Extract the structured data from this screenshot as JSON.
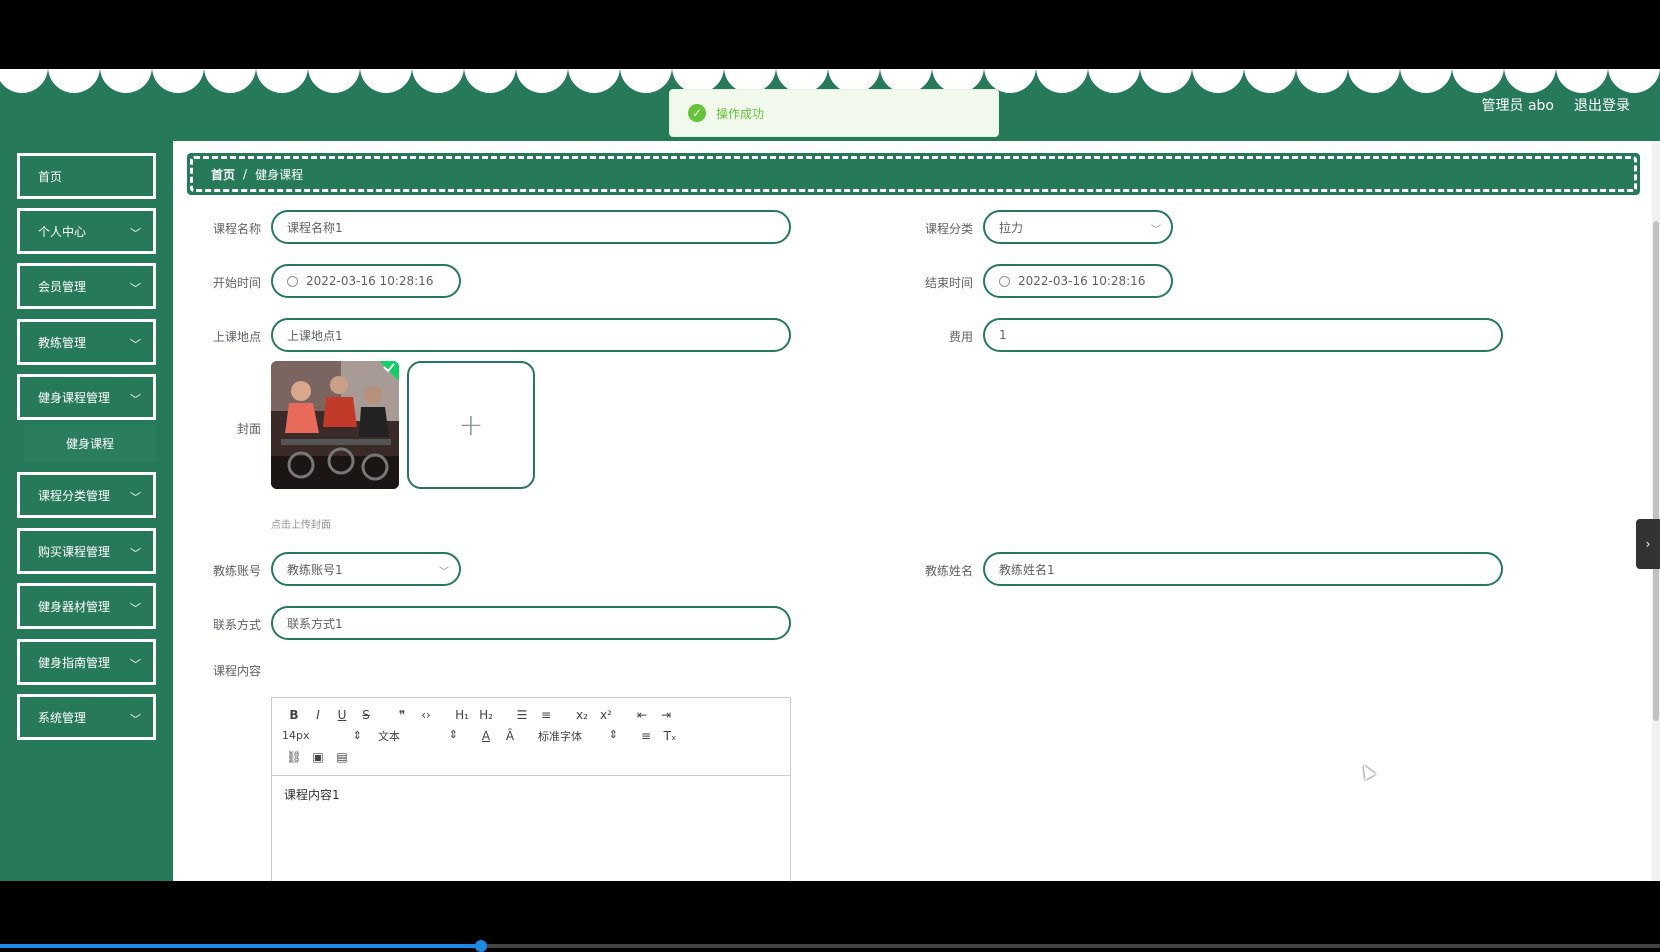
{
  "header": {
    "admin_label": "管理员 abo",
    "logout_label": "退出登录"
  },
  "toast": {
    "message": "操作成功",
    "icon": "check-circle-icon"
  },
  "sidebar": {
    "items": [
      {
        "label": "首页",
        "has_children": false
      },
      {
        "label": "个人中心",
        "has_children": true
      },
      {
        "label": "会员管理",
        "has_children": true
      },
      {
        "label": "教练管理",
        "has_children": true
      },
      {
        "label": "健身课程管理",
        "has_children": true
      },
      {
        "label": "课程分类管理",
        "has_children": true
      },
      {
        "label": "购买课程管理",
        "has_children": true
      },
      {
        "label": "健身器材管理",
        "has_children": true
      },
      {
        "label": "健身指南管理",
        "has_children": true
      },
      {
        "label": "系统管理",
        "has_children": true
      }
    ],
    "submenu": {
      "label": "健身课程"
    }
  },
  "breadcrumb": {
    "home": "首页",
    "separator": "/",
    "current": "健身课程"
  },
  "form": {
    "course_name": {
      "label": "课程名称",
      "value": "课程名称1"
    },
    "course_category": {
      "label": "课程分类",
      "value": "拉力"
    },
    "start_time": {
      "label": "开始时间",
      "value": "2022-03-16 10:28:16"
    },
    "end_time": {
      "label": "结束时间",
      "value": "2022-03-16 10:28:16"
    },
    "location": {
      "label": "上课地点",
      "value": "上课地点1"
    },
    "fee": {
      "label": "费用",
      "value": "1"
    },
    "cover": {
      "label": "封面",
      "hint": "点击上传封面",
      "upload_icon": "+"
    },
    "coach_account": {
      "label": "教练账号",
      "value": "教练账号1"
    },
    "coach_name": {
      "label": "教练姓名",
      "value": "教练姓名1"
    },
    "contact": {
      "label": "联系方式",
      "value": "联系方式1"
    },
    "content": {
      "label": "课程内容",
      "value": "课程内容1",
      "font_size": "14px",
      "text_type": "文本",
      "font_family": "标准字体"
    }
  },
  "colors": {
    "primary": "#267a5a",
    "success": "#67c23a"
  },
  "video": {
    "progress_fraction": 0.29
  }
}
